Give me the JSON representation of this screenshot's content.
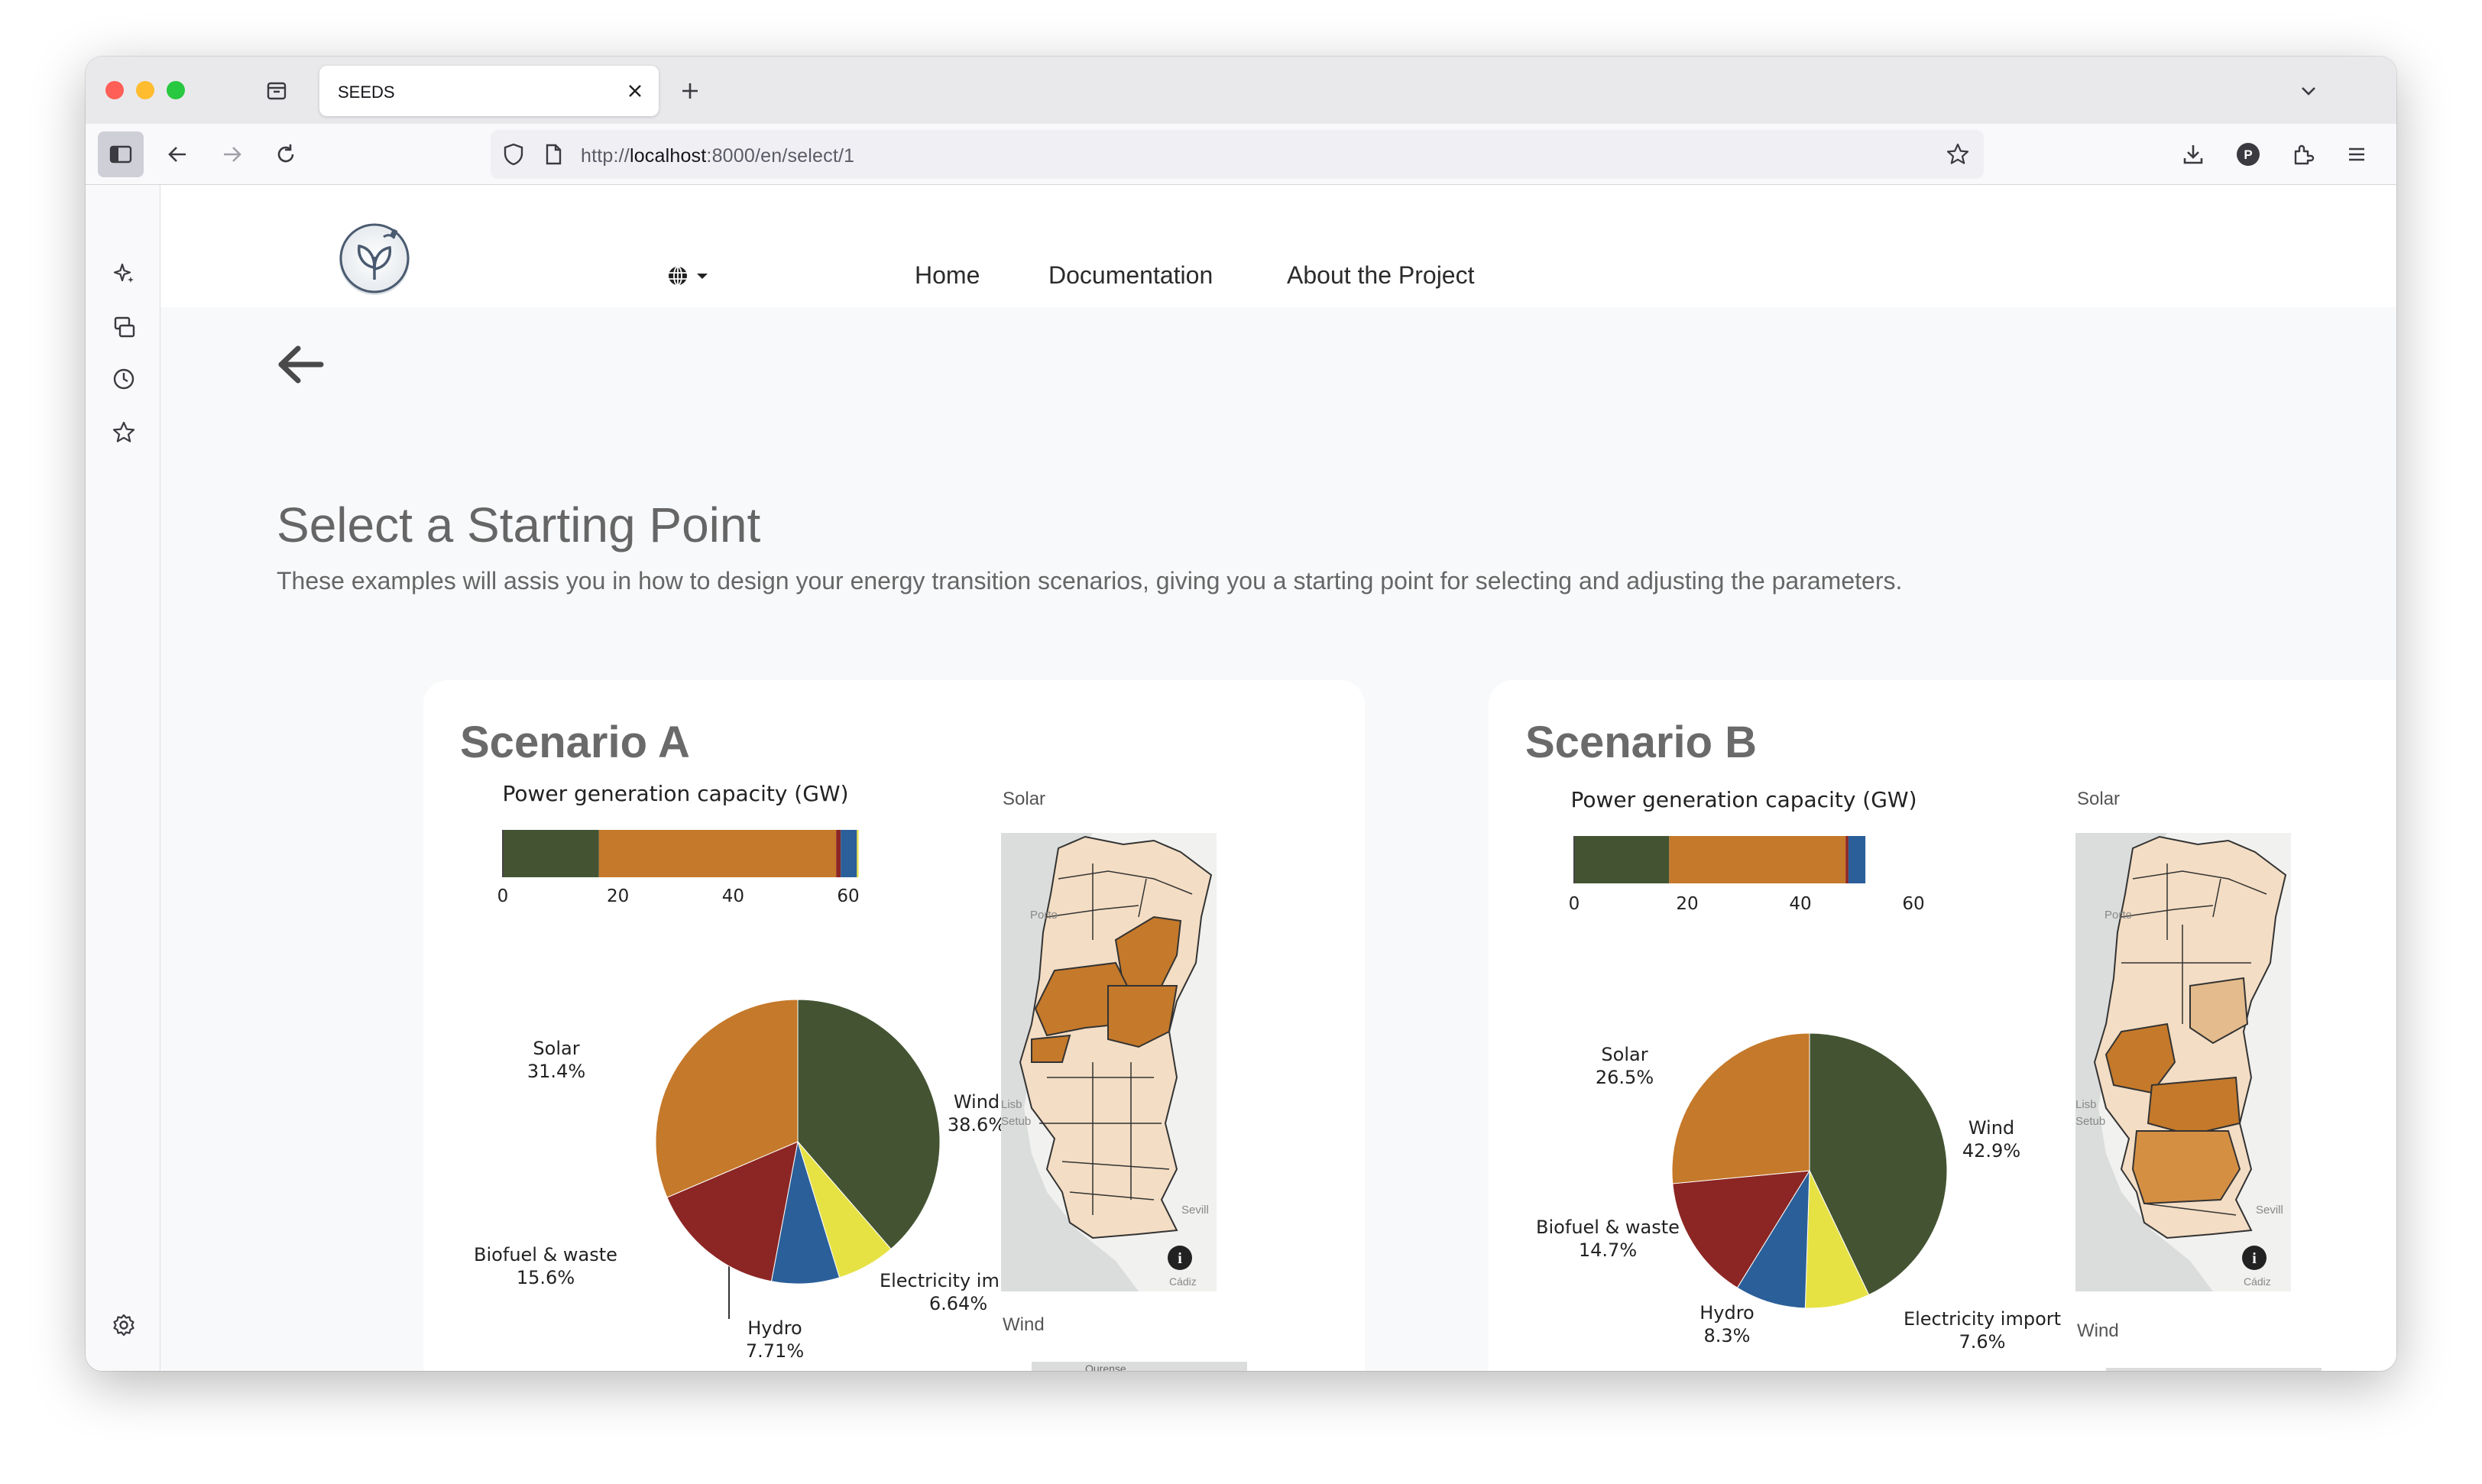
{
  "browser": {
    "tab_title": "SEEDS",
    "url_prefix": "http://",
    "url_host": "localhost",
    "url_rest": ":8000/en/select/1"
  },
  "navbar": {
    "links": [
      "Home",
      "Documentation",
      "About the Project"
    ]
  },
  "page": {
    "title": "Select a Starting Point",
    "subtitle": "These examples will assis you in how to design your energy transition scenarios, giving you a starting point for selecting and adjusting the parameters."
  },
  "colors": {
    "wind": "#445433",
    "solar": "#c5792a",
    "biofuel": "#8b2624",
    "hydro": "#2b5f99",
    "import": "#e6e244"
  },
  "icons": [
    "sidebar-icon",
    "back-icon",
    "forward-icon",
    "reload-icon",
    "shield-icon",
    "page-icon",
    "bookmark-star-icon",
    "download-icon",
    "profile-icon",
    "extensions-icon",
    "menu-icon",
    "ai-sparkle-icon",
    "synced-tabs-icon",
    "history-icon",
    "bookmarks-icon",
    "settings-icon",
    "globe-icon",
    "back-arrow-icon",
    "info-icon"
  ],
  "scenarios": [
    {
      "title": "Scenario A",
      "map_labels": {
        "solar": "Solar",
        "wind": "Wind"
      }
    },
    {
      "title": "Scenario B",
      "map_labels": {
        "solar": "Solar",
        "wind": "Wind"
      }
    }
  ],
  "chart_data": [
    {
      "type": "bar",
      "orientation": "horizontal-stacked",
      "title": "Power generation capacity (GW)",
      "xticks": [
        "0",
        "20",
        "40",
        "60"
      ],
      "xlim": [
        0,
        60
      ],
      "series": [
        {
          "name": "Wind",
          "values": [
            16.7
          ]
        },
        {
          "name": "Solar",
          "values": [
            41.2
          ]
        },
        {
          "name": "Biofuel & waste",
          "values": [
            0.8
          ]
        },
        {
          "name": "Hydro",
          "values": [
            2.8
          ]
        },
        {
          "name": "Electricity import",
          "values": [
            0.3
          ]
        }
      ]
    },
    {
      "type": "pie",
      "slices": [
        {
          "name": "Wind",
          "label": "Wind",
          "pct_label": "38.6%",
          "value": 38.6
        },
        {
          "name": "Electricity import",
          "label": "Electricity import",
          "pct_label": "6.64%",
          "value": 6.64
        },
        {
          "name": "Hydro",
          "label": "Hydro",
          "pct_label": "7.71%",
          "value": 7.71
        },
        {
          "name": "Biofuel & waste",
          "label": "Biofuel & waste",
          "pct_label": "15.6%",
          "value": 15.6
        },
        {
          "name": "Solar",
          "label": "Solar",
          "pct_label": "31.4%",
          "value": 31.4
        }
      ]
    },
    {
      "type": "bar",
      "orientation": "horizontal-stacked",
      "title": "Power generation capacity (GW)",
      "xticks": [
        "0",
        "20",
        "40",
        "60"
      ],
      "xlim": [
        0,
        60
      ],
      "series": [
        {
          "name": "Wind",
          "values": [
            16.8
          ]
        },
        {
          "name": "Solar",
          "values": [
            31.2
          ]
        },
        {
          "name": "Biofuel & waste",
          "values": [
            0.5
          ]
        },
        {
          "name": "Hydro",
          "values": [
            3.0
          ]
        }
      ]
    },
    {
      "type": "pie",
      "slices": [
        {
          "name": "Wind",
          "label": "Wind",
          "pct_label": "42.9%",
          "value": 42.9
        },
        {
          "name": "Electricity import",
          "label": "Electricity import",
          "pct_label": "7.6%",
          "value": 7.6
        },
        {
          "name": "Hydro",
          "label": "Hydro",
          "pct_label": "8.3%",
          "value": 8.3
        },
        {
          "name": "Biofuel & waste",
          "label": "Biofuel & waste",
          "pct_label": "14.7%",
          "value": 14.7
        },
        {
          "name": "Solar",
          "label": "Solar",
          "pct_label": "26.5%",
          "value": 26.5
        }
      ]
    }
  ],
  "map_text": {
    "porto": "Porto",
    "lisboa": "Lisb",
    "setubal": "Setub",
    "sevilla": "Sevill",
    "cadiz": "Cádiz",
    "ourense": "Ourense"
  }
}
